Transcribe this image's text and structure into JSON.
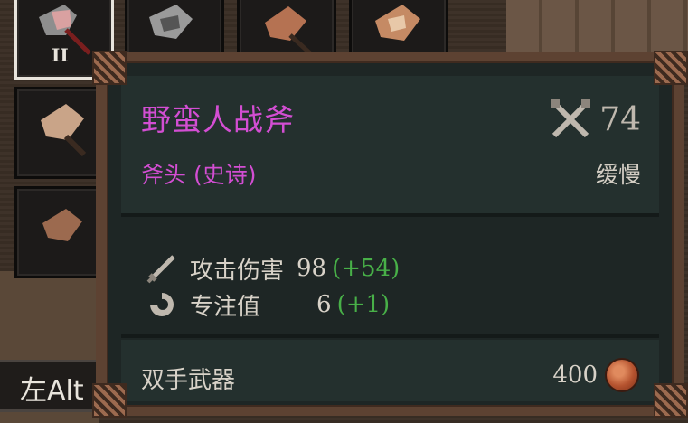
{
  "inventory": {
    "selected_slot_level": "II",
    "keyhint_label": "左Alt"
  },
  "tooltip": {
    "item_name": "野蛮人战斧",
    "item_subtitle": "斧头 (史诗)",
    "damage": "74",
    "speed": "缓慢",
    "stats": [
      {
        "label": "攻击伤害",
        "value": "98",
        "bonus": "(+54)",
        "icon": "sword-icon"
      },
      {
        "label": "专注值",
        "value": "6",
        "bonus": "(+1)",
        "icon": "focus-swirl-icon"
      }
    ],
    "weapon_type": "双手武器",
    "price": "400"
  },
  "colors": {
    "rarity_epic": "#d34ed3",
    "bonus_green": "#48b048",
    "panel_bg": "#1e2625",
    "frame_brown": "#5d4232"
  }
}
